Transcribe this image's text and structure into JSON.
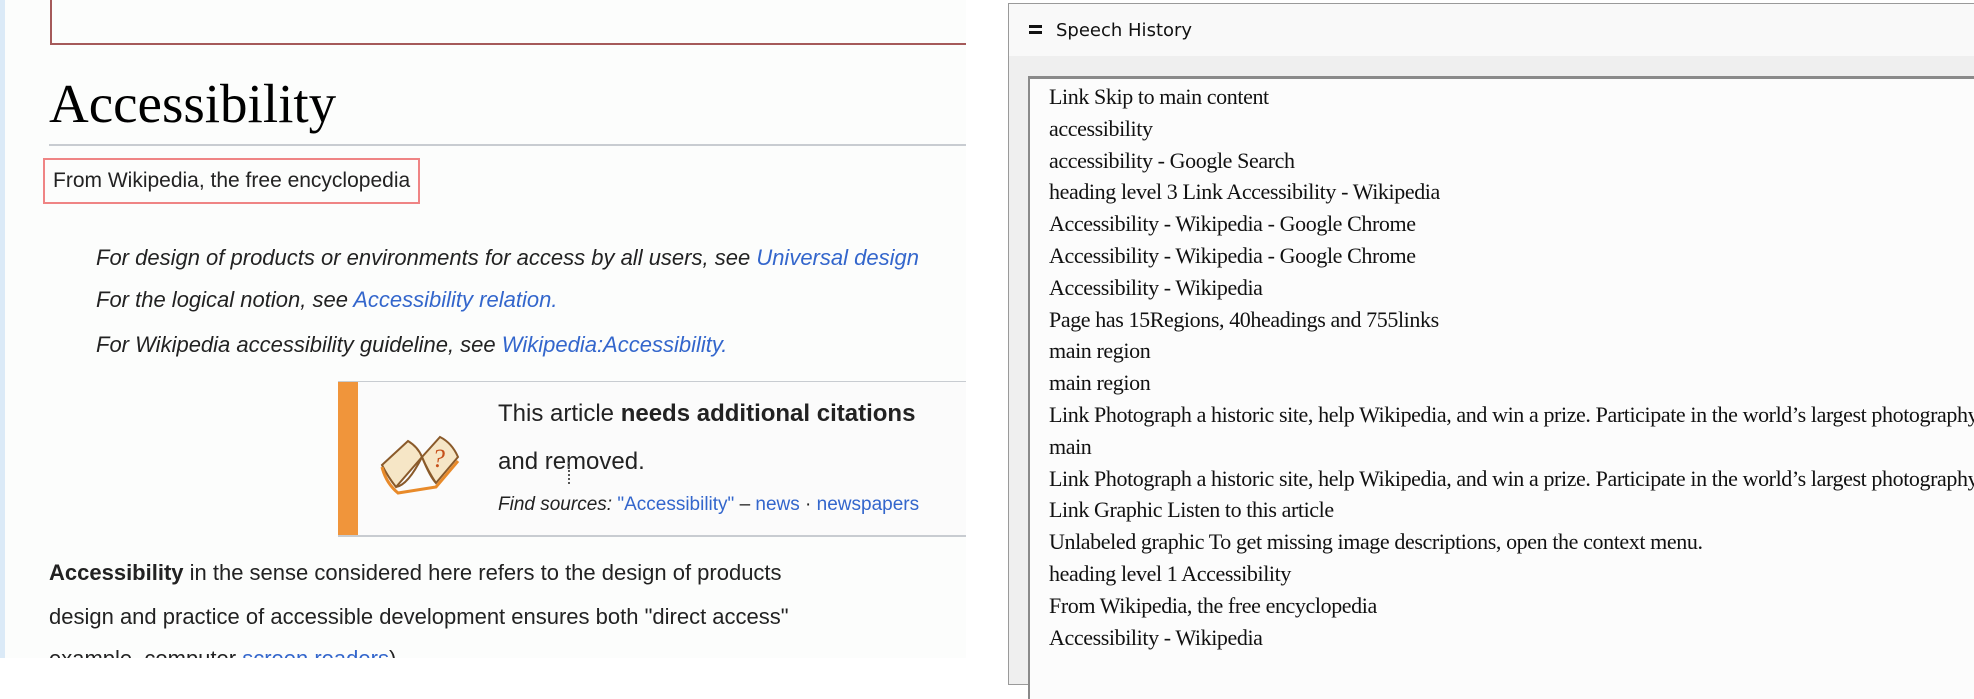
{
  "wikipedia": {
    "heading": "Accessibility",
    "tagline": "From Wikipedia, the free encyclopedia",
    "hatnotes": [
      {
        "text": "For design of products or environments for access by all users, see ",
        "link": "Universal design"
      },
      {
        "text": "For the logical notion, see ",
        "link": "Accessibility relation",
        "end": "."
      },
      {
        "text": "For Wikipedia accessibility guideline, see ",
        "link": "Wikipedia:Accessibility",
        "end": "."
      }
    ],
    "ambox": {
      "icon": "book-question-icon",
      "line1_prefix": "This article ",
      "line1_bold": "needs additional citations",
      "line2": "and removed.",
      "line3_label": "Find sources:",
      "line3_query": "\"Accessibility\"",
      "line3_dash": " – ",
      "line3_links": [
        "news",
        "newspapers"
      ],
      "line3_sep": " · "
    },
    "paragraph": {
      "bold": "Accessibility",
      "line1_rest": " in the sense considered here refers to the design of products",
      "line2": "design and practice of accessible development ensures both \"direct access\"",
      "line3_prefix": "example, computer ",
      "line3_link": "screen readers",
      "line3_suffix": ")."
    }
  },
  "speech_history": {
    "title": "Speech History",
    "menu_icon": "menu-icon",
    "items": [
      "Link Skip to main content",
      "accessibility",
      "accessibility - Google Search",
      "heading level 3 Link Accessibility - Wikipedia",
      "Accessibility - Wikipedia - Google Chrome",
      "Accessibility - Wikipedia - Google Chrome",
      "Accessibility - Wikipedia",
      "Page has 15Regions, 40headings and 755links",
      "main region",
      "main region",
      "Link Photograph a historic site, help Wikipedia, and win a prize. Participate in the world’s largest photography competition this month!",
      "main",
      "Link Photograph a historic site, help Wikipedia, and win a prize. Participate in the world’s largest photography competition this month!",
      "Link Graphic Listen to this article",
      " Unlabeled graphic  To get missing image descriptions, open the context menu.",
      "heading level 1 Accessibility",
      "From Wikipedia, the free encyclopedia",
      "Accessibility - Wikipedia",
      ""
    ]
  }
}
